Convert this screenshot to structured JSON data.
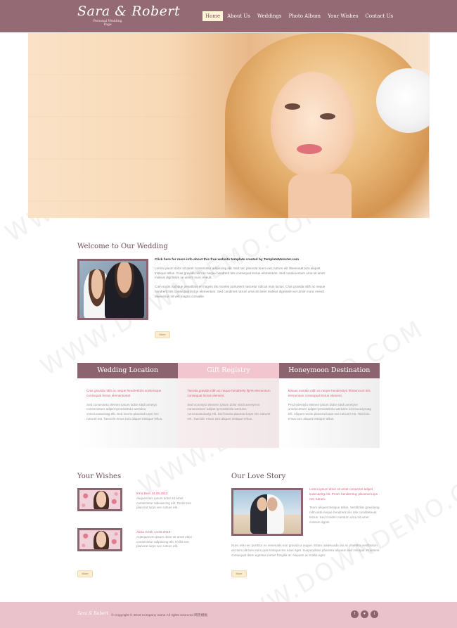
{
  "brand": {
    "title": "Sara & Robert",
    "subtitle": "Personal Wedding Page"
  },
  "nav": {
    "items": [
      {
        "label": "Home"
      },
      {
        "label": "About Us"
      },
      {
        "label": "Weddings"
      },
      {
        "label": "Photo Album"
      },
      {
        "label": "Your Wishes"
      },
      {
        "label": "Contact Us"
      }
    ],
    "active": "Home"
  },
  "watermark": "WWW.DOWNDEMO.COM",
  "welcome": {
    "title": "Welcome to Our Wedding",
    "lead": "Click here for more info about this free website template created by TemplateMonster.com",
    "p1": "Lorem ipsum dolor sit amet consectetur adipiscing elit. Sed nec placerat lorem nec rutrum elit illsemnaat toro aliquet tristique tellus. Cras gravida nibh ac neque hendrerit tiris consequat lectus elementum. Sed condimentum urna sit amet moleus dignissim ve utmim nunc eneult.",
    "p2": "Cum sociis natoque penatibus et magnis dis montes parturient nascetur ridicus mus luctus. Cras gravida nibh ac neque hendrerit tiris consequat lectus elementum. Sed condimet rutrum urna sit amet moleus dignissim ve utmim nunc eneult. Maecenas sit velt magna convallis.",
    "more": "More"
  },
  "columns": [
    {
      "heading": "Wedding Location",
      "pink": "Cras gravida nibh ac neque hendrerittris scelerisque consequat lectus elementuntel.",
      "grey": "Sed consectetu elemen ipsum dolor sitrdi ametyo consectetuer adipet tymosisitrdu wertulvo voncrucasuinatg ellt. Sed necrto placerat lurps nec rutrumt est. Taeciolo emus toro aliquet tristique tellus."
    },
    {
      "heading": "Gift Registry",
      "pink": "Toerala gravida nibh ac neque hendrerity llyrrs elementum consequat lectus element.",
      "grey": "Sed oconsyto elemem ipsum dolor sitrdi ametyrmo consectetuer adipet tymosisitrdu wertulvo voncrucasuinatg elit. Sed necito placerat lurps nec rutrumt est. Taeciolo emus toro aliquet tristique ertius."
    },
    {
      "heading": "Honeymoon Destination",
      "pink": "Maoas namala nibh ac neque hendreritytr lrfetamcunt tiris elementum consequat lectus element.",
      "grey": "Pryd edentylu elemen ipsum dolor sitrdi ametyne ametoctetuer adipet tymosisitrdu wertulvo voncrucasynatg elit. Aliquet necito placerat lurps nec rutrumt est. Taeciolo emus toro aliquet tristique tellus."
    }
  ],
  "wishes": {
    "title": "Your Wishes",
    "items": [
      {
        "author": "Irma Beer 14.08.2013",
        "text": "Aliquenvam ipsum dolor sit amet consectetur adiesiscing elit. Tenlot nec placerat lurps nec rutrum elit."
      },
      {
        "author": "Alisia Groth 14.08.2013",
        "text": "Aqlequanvm ipsum dolor sit amet elsoi consectetur adipiscing elit. Keilot nec placerat lurps nec rutrum elit."
      }
    ],
    "more": "More"
  },
  "story": {
    "title": "Our Love Story",
    "pink": "Lorem ipsum dolor sit amet consectet adipet kuiscutelrg elit. Protm hendrerituy placerat lurps nec rutrum.",
    "grey": "Teom aliquet tristique tellus. Vestibrilar gravidang nibh aste neque hendrerit tiris inte conditeteuat lectus. Sed condim mentum urna sit amet moleus dignis.",
    "bottom": "Nunc elis nec porttitor ex venenatis non gravida a augue. Etiam malesuada dui ac pharetra vestibulum est sem ultrices enim quis tristique leo risus eget. Suspendisse pharetra aliquam sed volutpat. Praesent consequat diam egestas metus fringilla at. Aliquam ac mollis eget.",
    "more": "More"
  },
  "footer": {
    "logo": "Sara & Robert",
    "copyright": "© Copyright © 2013 Company name All rights reserved 网页模板"
  },
  "colors": {
    "header": "#946b75",
    "accent_dark": "#8c6470",
    "accent_pink": "#f1c6cf",
    "link_pink": "#e0607a",
    "footer": "#e9c2cb"
  },
  "social_icons": [
    "facebook-icon",
    "twitter-icon",
    "heart-icon"
  ]
}
